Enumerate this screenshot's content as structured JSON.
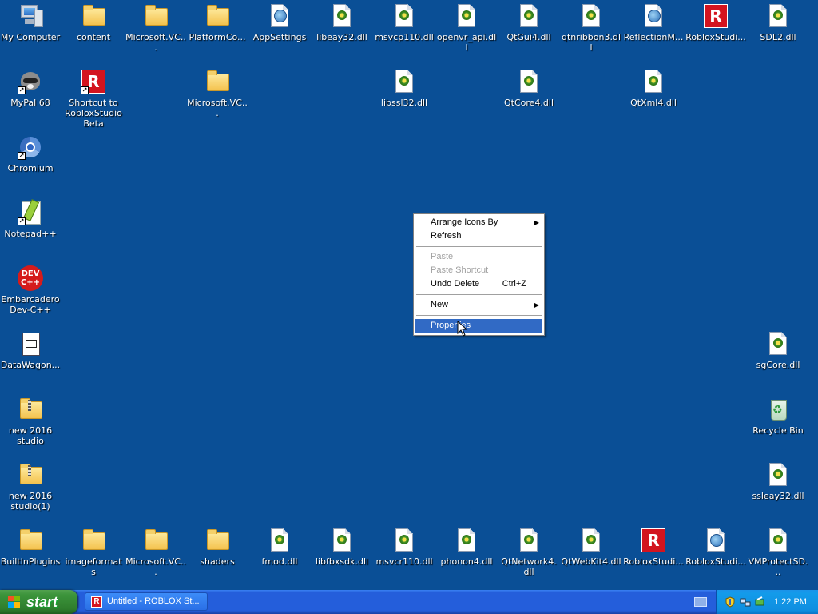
{
  "desktop": {
    "icons": [
      {
        "label": "My Computer",
        "kind": "computer"
      },
      {
        "label": "content",
        "kind": "folder"
      },
      {
        "label": "Microsoft.VC...",
        "kind": "folder"
      },
      {
        "label": "PlatformCo...",
        "kind": "folder"
      },
      {
        "label": "AppSettings",
        "kind": "xml"
      },
      {
        "label": "libeay32.dll",
        "kind": "dll"
      },
      {
        "label": "msvcp110.dll",
        "kind": "dll"
      },
      {
        "label": "openvr_api.dll",
        "kind": "dll"
      },
      {
        "label": "QtGui4.dll",
        "kind": "dll"
      },
      {
        "label": "qtnribbon3.dll",
        "kind": "dll"
      },
      {
        "label": "ReflectionM...",
        "kind": "xml"
      },
      {
        "label": "RobloxStudi...",
        "kind": "roblox"
      },
      {
        "label": "SDL2.dll",
        "kind": "dll"
      },
      {
        "label": "MyPal 68",
        "kind": "raccoon",
        "shortcut": true
      },
      {
        "label": "Shortcut to RobloxStudioBeta",
        "kind": "roblox",
        "shortcut": true
      },
      {
        "label": "Microsoft.VC...",
        "kind": "folder"
      },
      {
        "label": "libssl32.dll",
        "kind": "dll"
      },
      {
        "label": "QtCore4.dll",
        "kind": "dll"
      },
      {
        "label": "QtXml4.dll",
        "kind": "dll"
      },
      {
        "label": "Chromium",
        "kind": "chromium",
        "shortcut": true
      },
      {
        "label": "Notepad++",
        "kind": "notepadpp",
        "shortcut": true
      },
      {
        "label": "Embarcadero Dev-C++",
        "kind": "devcpp"
      },
      {
        "label": "DataWagon...",
        "kind": "datawagon"
      },
      {
        "label": "new 2016 studio",
        "kind": "zipfolder"
      },
      {
        "label": "new 2016 studio(1)",
        "kind": "zipfolder"
      },
      {
        "label": "sgCore.dll",
        "kind": "dll"
      },
      {
        "label": "Recycle Bin",
        "kind": "recycle"
      },
      {
        "label": "ssleay32.dll",
        "kind": "dll"
      },
      {
        "label": "BuiltInPlugins",
        "kind": "folder"
      },
      {
        "label": "imageformats",
        "kind": "folder"
      },
      {
        "label": "Microsoft.VC...",
        "kind": "folder"
      },
      {
        "label": "shaders",
        "kind": "folder"
      },
      {
        "label": "fmod.dll",
        "kind": "dll"
      },
      {
        "label": "libfbxsdk.dll",
        "kind": "dll"
      },
      {
        "label": "msvcr110.dll",
        "kind": "dll"
      },
      {
        "label": "phonon4.dll",
        "kind": "dll"
      },
      {
        "label": "QtNetwork4.dll",
        "kind": "dll"
      },
      {
        "label": "QtWebKit4.dll",
        "kind": "dll"
      },
      {
        "label": "RobloxStudi...",
        "kind": "roblox"
      },
      {
        "label": "RobloxStudi...",
        "kind": "xml"
      },
      {
        "label": "VMProtectSD...",
        "kind": "dll"
      }
    ],
    "dev_badge": "DEV",
    "dev_badge2": "C++"
  },
  "context_menu": {
    "items": [
      {
        "label": "Arrange Icons By",
        "submenu": true
      },
      {
        "label": "Refresh"
      },
      {
        "label": "Paste",
        "disabled": true
      },
      {
        "label": "Paste Shortcut",
        "disabled": true
      },
      {
        "label": "Undo Delete",
        "shortcut": "Ctrl+Z"
      },
      {
        "label": "New",
        "submenu": true
      },
      {
        "label": "Properties",
        "selected": true
      }
    ],
    "submenu_glyph": "▶"
  },
  "taskbar": {
    "start_label": "start",
    "window_button": {
      "label": "Untitled - ROBLOX St...",
      "icon_letter": "R"
    },
    "clock": "1:22 PM"
  },
  "colors": {
    "desktop": "#0a4f96",
    "menu_highlight": "#316ac5",
    "taskbar": "#245edb",
    "start_button": "#3c943b",
    "tray": "#0f8ee0"
  }
}
